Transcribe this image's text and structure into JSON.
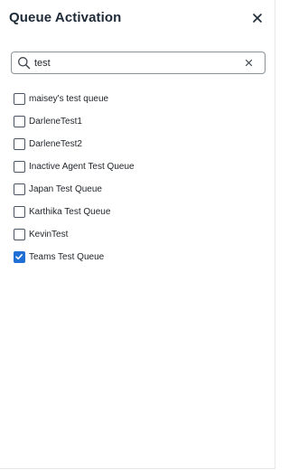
{
  "dialog": {
    "title": "Queue Activation",
    "close_icon": "close-icon"
  },
  "search": {
    "icon": "search-icon",
    "value": "test",
    "clear_icon": "clear-icon"
  },
  "queues": [
    {
      "label": "maisey's test queue",
      "checked": false
    },
    {
      "label": "DarleneTest1",
      "checked": false
    },
    {
      "label": "DarleneTest2",
      "checked": false
    },
    {
      "label": "Inactive Agent Test Queue",
      "checked": false
    },
    {
      "label": "Japan Test Queue",
      "checked": false
    },
    {
      "label": "Karthika Test Queue",
      "checked": false
    },
    {
      "label": "KevinTest",
      "checked": false
    },
    {
      "label": "Teams Test Queue",
      "checked": true
    }
  ],
  "colors": {
    "accent": "#1f6fd6",
    "checkbox_border": "#4a5563",
    "search_border": "#8a939b"
  }
}
